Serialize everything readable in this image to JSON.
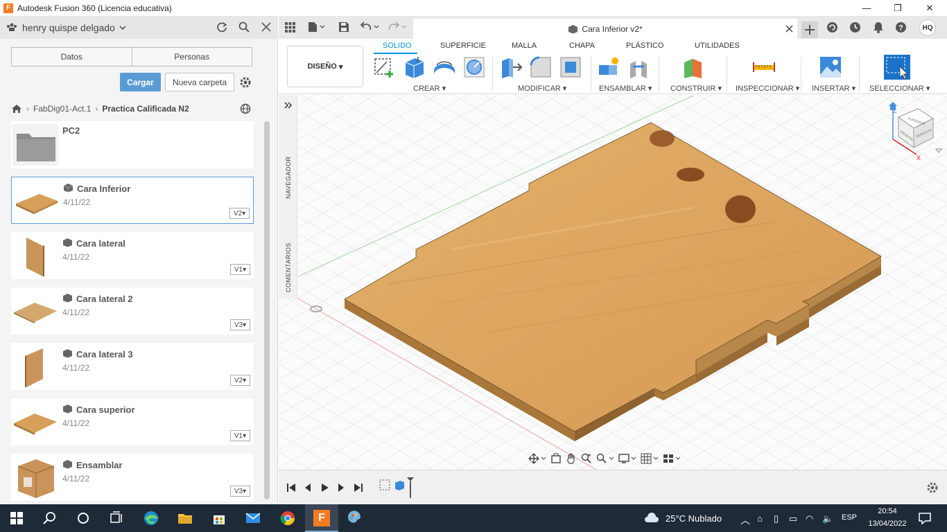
{
  "window": {
    "title": "Autodesk Fusion 360 (Licencia educativa)",
    "controls": [
      "—",
      "❐",
      "✕"
    ]
  },
  "data_panel": {
    "user": "henry quispe delgado",
    "tabs": [
      "Datos",
      "Personas"
    ],
    "upload_label": "Cargar",
    "new_folder_label": "Nueva carpeta",
    "breadcrumb": {
      "project": "FabDig01-Act.1",
      "folder": "Practica Calificada N2"
    },
    "items": [
      {
        "name": "PC2",
        "type": "folder"
      },
      {
        "name": "Cara Inferior",
        "date": "4/11/22",
        "version": "V2",
        "selected": true
      },
      {
        "name": "Cara lateral",
        "date": "4/11/22",
        "version": "V1"
      },
      {
        "name": "Cara lateral 2",
        "date": "4/11/22",
        "version": "V3"
      },
      {
        "name": "Cara lateral 3",
        "date": "4/11/22",
        "version": "V2"
      },
      {
        "name": "Cara superior",
        "date": "4/11/22",
        "version": "V1"
      },
      {
        "name": "Ensamblar",
        "date": "4/11/22",
        "version": "V3"
      }
    ]
  },
  "document": {
    "tab_title": "Cara Inferior v2*",
    "user_initials": "HQ"
  },
  "toolbar": {
    "workspace": "DISEÑO",
    "tabs": [
      "SOLIDO",
      "SUPERFICIE",
      "MALLA",
      "CHAPA",
      "PLÁSTICO",
      "UTILIDADES"
    ],
    "active_tab": "SOLIDO",
    "groups": [
      "CREAR",
      "MODIFICAR",
      "ENSAMBLAR",
      "CONSTRUIR",
      "INSPECCIONAR",
      "INSERTAR",
      "SELECCIONAR"
    ]
  },
  "browser": {
    "navigator_label": "NAVEGADOR",
    "comments_label": "COMENTARIOS"
  },
  "viewcube": {
    "faces": [
      "SUPERIOR",
      "FRONTAL",
      "DERECHA"
    ],
    "axes": [
      "Z",
      "X"
    ]
  },
  "taskbar": {
    "weather": "25°C  Nublado",
    "language": "ESP",
    "time": "20:54",
    "date": "13/04/2022"
  },
  "colors": {
    "accent": "#0696d7",
    "primary_button": "#5b9bd5",
    "wood": "#d9a45c",
    "taskbar": "#1f2a38"
  }
}
